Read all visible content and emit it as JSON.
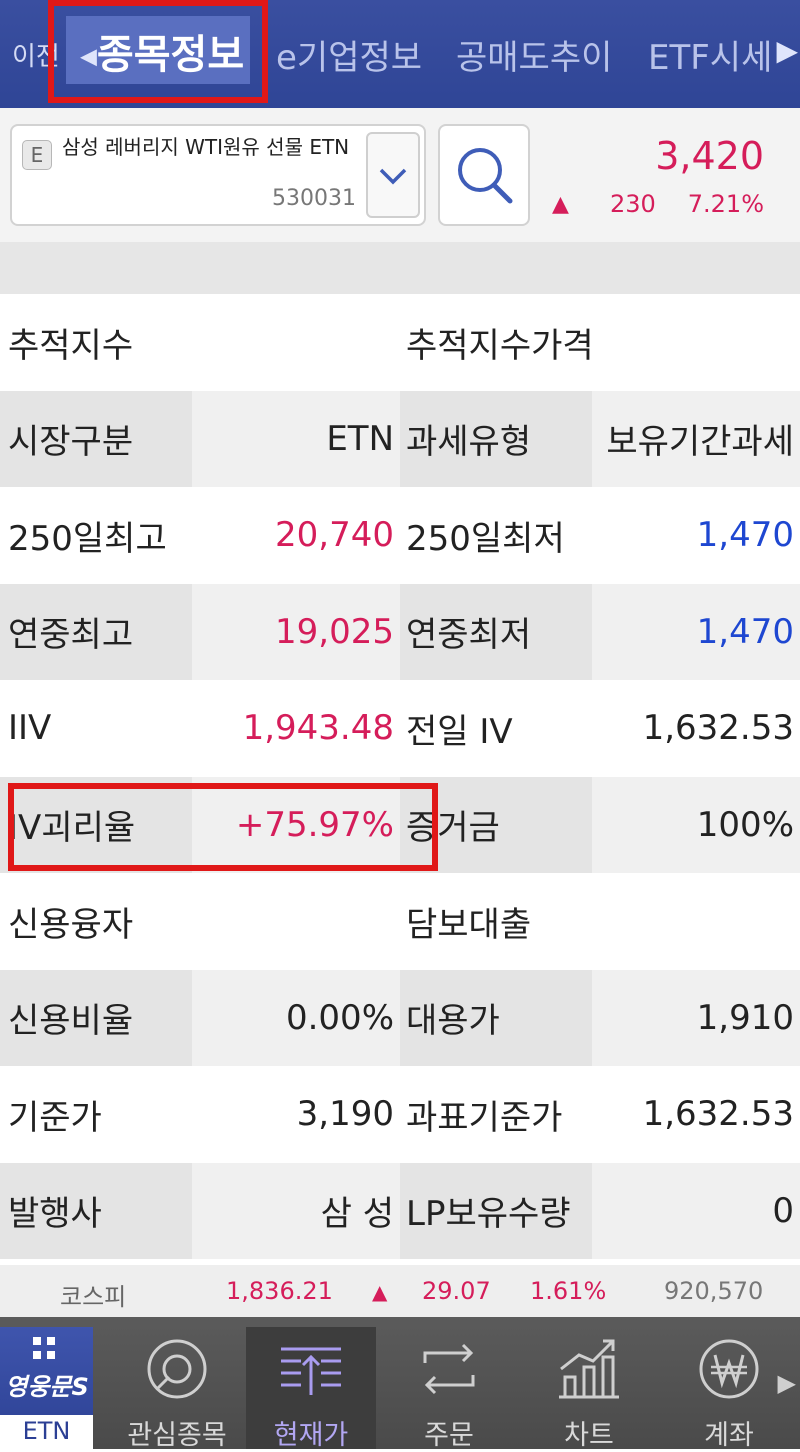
{
  "tabs": {
    "prev_label": "이전",
    "active_label": "종목정보",
    "tab3": "e기업정보",
    "tab4": "공매도추이",
    "tab5": "ETF시세"
  },
  "stock": {
    "badge": "E",
    "name": "삼성 레버리지 WTI원유 선물 ETN",
    "code": "530031",
    "price": "3,420",
    "change_arrow": "▲",
    "change": "230",
    "change_pct": "7.21%"
  },
  "info_rows": [
    {
      "l1": "추적지수",
      "v1": "",
      "l2": "추적지수가격",
      "v2": ""
    },
    {
      "l1": "시장구분",
      "v1": "ETN",
      "l2": "과세유형",
      "v2": "보유기간과세"
    },
    {
      "l1": "250일최고",
      "v1": "20,740",
      "l2": "250일최저",
      "v2": "1,470"
    },
    {
      "l1": "연중최고",
      "v1": "19,025",
      "l2": "연중최저",
      "v2": "1,470"
    },
    {
      "l1": "IIV",
      "v1": "1,943.48",
      "l2": "전일 IV",
      "v2": "1,632.53"
    },
    {
      "l1": "IV괴리율",
      "v1": "+75.97%",
      "l2": "증거금",
      "v2": "100%"
    },
    {
      "l1": "신용융자",
      "v1": "",
      "l2": "담보대출",
      "v2": ""
    },
    {
      "l1": "신용비율",
      "v1": "0.00%",
      "l2": "대용가",
      "v2": "1,910"
    },
    {
      "l1": "기준가",
      "v1": "3,190",
      "l2": "과표기준가",
      "v2": "1,632.53"
    },
    {
      "l1": "발행사",
      "v1": "삼  성",
      "l2": "LP보유수량",
      "v2": "0"
    }
  ],
  "ticker": {
    "name": "코스피",
    "value": "1,836.21",
    "arrow": "▲",
    "change": "29.07",
    "change_pct": "1.61%",
    "volume": "920,570"
  },
  "bottom_nav": {
    "logo_text": "영웅문S",
    "logo_label": "ETN",
    "items": [
      "관심종목",
      "현재가",
      "주문",
      "차트",
      "계좌"
    ]
  },
  "colors": {
    "up": "#d51d5a",
    "down": "#1e47d1",
    "header": "#3a4fa0",
    "highlight": "#e01818"
  }
}
